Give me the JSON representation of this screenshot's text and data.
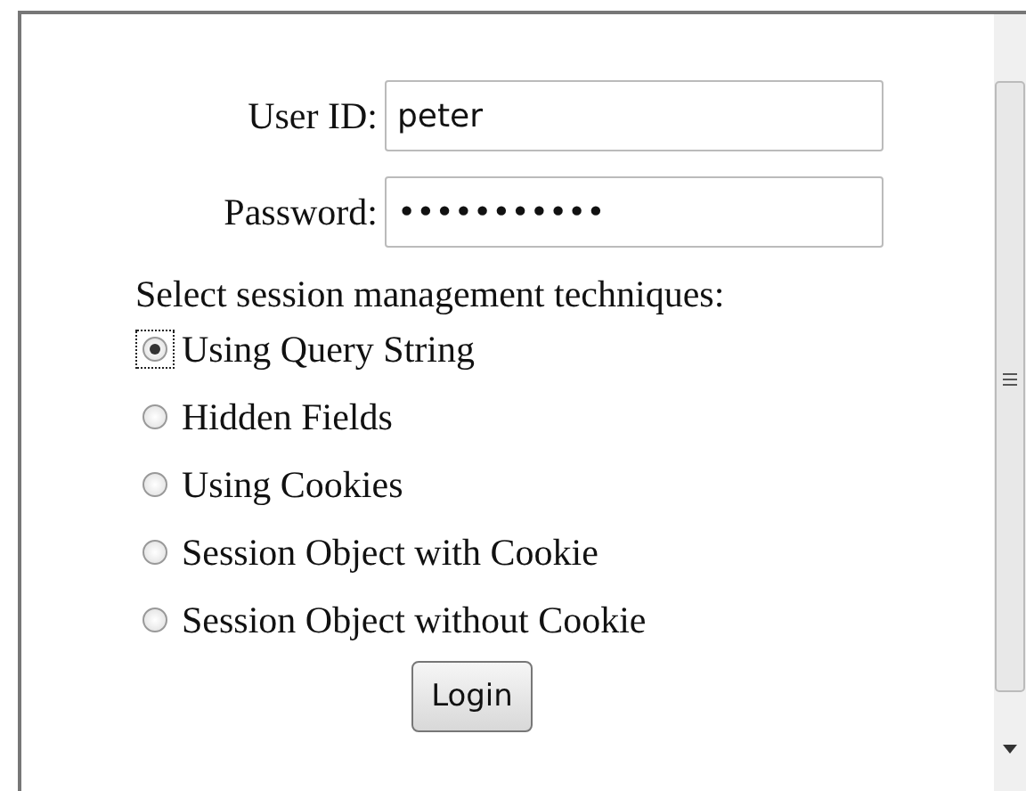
{
  "fields": [
    {
      "label": "User ID:",
      "value": "peter"
    },
    {
      "label": "Password:",
      "value": "•••••••••••"
    }
  ],
  "prompt": "Select session management techniques:",
  "options": [
    {
      "label": "Using Query String",
      "selected": true
    },
    {
      "label": "Hidden Fields",
      "selected": false
    },
    {
      "label": "Using Cookies",
      "selected": false
    },
    {
      "label": "Session Object with Cookie",
      "selected": false
    },
    {
      "label": "Session Object without Cookie",
      "selected": false
    }
  ],
  "button": "Login"
}
